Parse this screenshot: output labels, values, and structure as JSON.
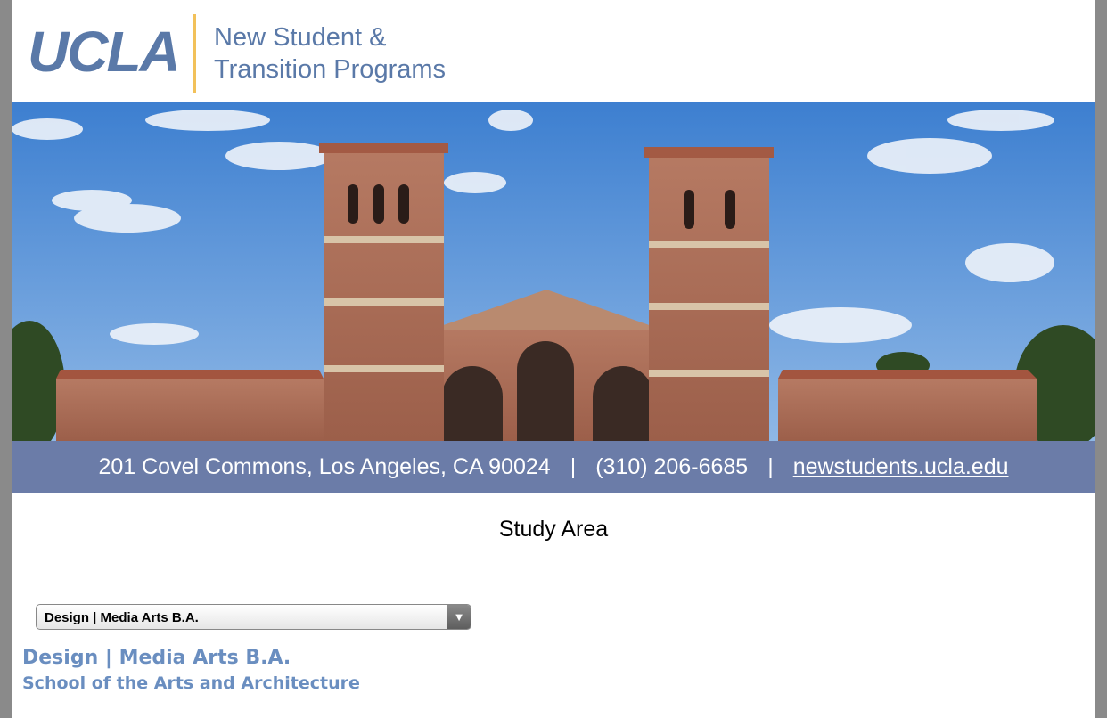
{
  "header": {
    "logo_text": "UCLA",
    "program_line1": "New Student &",
    "program_line2": "Transition Programs"
  },
  "hero": {
    "image_subject": "royce-hall-photo"
  },
  "contact": {
    "address": "201 Covel Commons, Los Angeles, CA 90024",
    "separator": "|",
    "phone": "(310) 206-6685",
    "website": "newstudents.ucla.edu"
  },
  "main": {
    "section_title": "Study Area",
    "select": {
      "selected": "Design | Media Arts B.A.",
      "arrow_icon": "▼"
    },
    "major": "Design | Media Arts B.A.",
    "school": "School of the Arts and Architecture"
  },
  "colors": {
    "brand_blue": "#5a79a8",
    "gold": "#f2c15a",
    "contact_bar": "#6b7ca8",
    "link_blue": "#6a8ec0"
  }
}
